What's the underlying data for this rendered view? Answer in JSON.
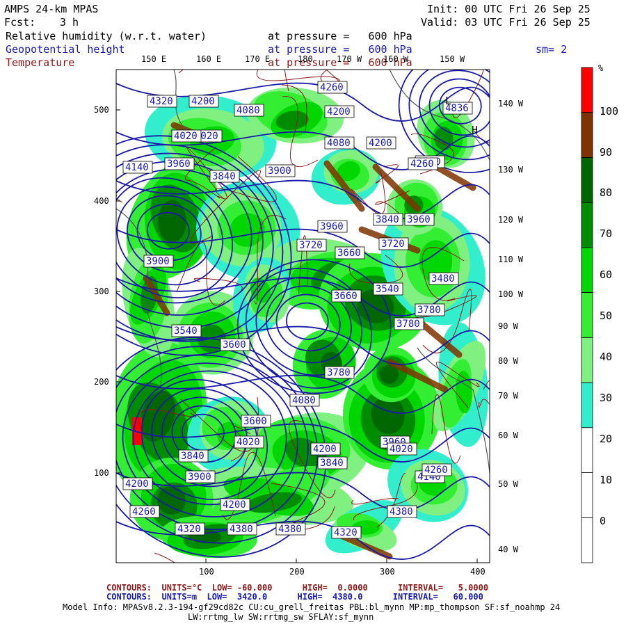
{
  "header": {
    "model_title": "AMPS 24-km MPAS",
    "fcst_label": "Fcst:",
    "fcst_value": "3 h",
    "init": "Init: 00 UTC Fri 26 Sep 25",
    "valid": "Valid: 03 UTC Fri 26 Sep 25",
    "field1_name": "Relative humidity (w.r.t. water)",
    "field1_level": "at pressure =   600 hPa",
    "field2_name": "Geopotential height",
    "field2_level": "at pressure =   600 hPa",
    "field3_name": "Temperature",
    "field3_level": "at pressure =   600 hPa",
    "smoothing": "sm= 2"
  },
  "map": {
    "top_longitudes": [
      "150 E",
      "160 E",
      "170 E",
      "180",
      "170 W",
      "160 W",
      "150 W"
    ],
    "right_longitudes": [
      "140 W",
      "130 W",
      "120 W",
      "110 W",
      "100 W",
      "90 W",
      "80 W",
      "70 W",
      "60 W",
      "50 W",
      "40 W"
    ],
    "y_ticks": [
      "500",
      "400",
      "300",
      "200",
      "100"
    ],
    "x_ticks": [
      "100",
      "200",
      "300",
      "400"
    ],
    "height_labels": [
      "4320",
      "4200",
      "4080",
      "4020",
      "4200",
      "4260",
      "3960",
      "3840",
      "3900",
      "3960",
      "4260",
      "4140",
      "3960",
      "3840",
      "3900",
      "3720",
      "3720",
      "3660",
      "3600",
      "3780",
      "4320",
      "4380",
      "4380",
      "4200",
      "4260",
      "4200",
      "4140",
      "4080",
      "4020",
      "3960",
      "3900",
      "3840",
      "3780",
      "3660",
      "3600",
      "3540",
      "3480",
      "3540",
      "4020",
      "3780",
      "3840",
      "4260",
      "4320",
      "4380",
      "4200",
      "4260",
      "4200",
      "4080",
      "4020",
      "4836"
    ],
    "low_label": "L",
    "high_label": "H"
  },
  "colorbar": {
    "unit": "%",
    "labels": [
      "100",
      "90",
      "80",
      "70",
      "60",
      "50",
      "40",
      "30",
      "20",
      "10",
      "0"
    ],
    "colors": [
      "#ff0000",
      "#7f3300",
      "#006600",
      "#008c00",
      "#00d600",
      "#33ee33",
      "#80f080",
      "#33eecc",
      "#ffffff",
      "#ffffff",
      "#ffffff"
    ]
  },
  "footer": {
    "temp_contours": "CONTOURS:  UNITS=°C  LOW= -60.000      HIGH=  0.0000      INTERVAL=   5.0000",
    "hgt_contours": "CONTOURS:  UNITS=m  LOW=  3420.0      HIGH=  4380.0      INTERVAL=   60.000",
    "model_info_1": "Model Info: MPASv8.2.3-194-gf29cd82c CU:cu_grell_freitas PBL:bl_mynn MP:mp_thompson SF:sf_noahmp 24",
    "model_info_2": "LW:rrtmg_lw SW:rrtmg_sw SFLAY:sf_mynn"
  }
}
